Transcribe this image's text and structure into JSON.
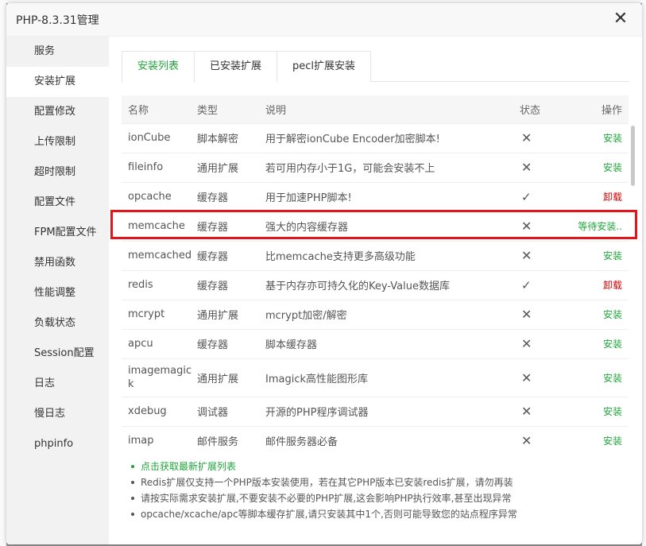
{
  "window": {
    "title": "PHP-8.3.31管理",
    "close_glyph": "✕"
  },
  "sidebar": {
    "items": [
      {
        "label": "服务"
      },
      {
        "label": "安装扩展",
        "active": true
      },
      {
        "label": "配置修改"
      },
      {
        "label": "上传限制"
      },
      {
        "label": "超时限制"
      },
      {
        "label": "配置文件"
      },
      {
        "label": "FPM配置文件"
      },
      {
        "label": "禁用函数"
      },
      {
        "label": "性能调整"
      },
      {
        "label": "负载状态"
      },
      {
        "label": "Session配置"
      },
      {
        "label": "日志"
      },
      {
        "label": "慢日志"
      },
      {
        "label": "phpinfo"
      }
    ]
  },
  "tabs": [
    {
      "label": "安装列表",
      "active": true
    },
    {
      "label": "已安装扩展"
    },
    {
      "label": "pecl扩展安装"
    }
  ],
  "table": {
    "headers": {
      "name": "名称",
      "type": "类型",
      "desc": "说明",
      "status": "状态",
      "op": "操作"
    },
    "rows": [
      {
        "name": "ionCube",
        "type": "脚本解密",
        "desc": "用于解密ionCube Encoder加密脚本!",
        "status": "✕",
        "op": "安装",
        "op_kind": "install"
      },
      {
        "name": "fileinfo",
        "type": "通用扩展",
        "desc": "若可用内存小于1G，可能会安装不上",
        "status": "✕",
        "op": "安装",
        "op_kind": "install"
      },
      {
        "name": "opcache",
        "type": "缓存器",
        "desc": "用于加速PHP脚本!",
        "status": "✓",
        "op": "卸载",
        "op_kind": "uninstall"
      },
      {
        "name": "memcache",
        "type": "缓存器",
        "desc": "强大的内容缓存器",
        "status": "✕",
        "op": "等待安装..",
        "op_kind": "pending"
      },
      {
        "name": "memcached",
        "type": "缓存器",
        "desc": "比memcache支持更多高级功能",
        "status": "✕",
        "op": "安装",
        "op_kind": "install"
      },
      {
        "name": "redis",
        "type": "缓存器",
        "desc": "基于内存亦可持久化的Key-Value数据库",
        "status": "✓",
        "op": "卸载",
        "op_kind": "uninstall"
      },
      {
        "name": "mcrypt",
        "type": "通用扩展",
        "desc": "mcrypt加密/解密",
        "status": "✕",
        "op": "安装",
        "op_kind": "install"
      },
      {
        "name": "apcu",
        "type": "缓存器",
        "desc": "脚本缓存器",
        "status": "✕",
        "op": "安装",
        "op_kind": "install"
      },
      {
        "name": "imagemagick",
        "name_line1": "imagemagic",
        "name_line2": "k",
        "type": "通用扩展",
        "desc": "Imagick高性能图形库",
        "status": "✕",
        "op": "安装",
        "op_kind": "install"
      },
      {
        "name": "xdebug",
        "type": "调试器",
        "desc": "开源的PHP程序调试器",
        "status": "✕",
        "op": "安装",
        "op_kind": "install"
      },
      {
        "name": "imap",
        "type": "邮件服务",
        "desc": "邮件服务器必备",
        "status": "✕",
        "op": "安装",
        "op_kind": "install"
      }
    ]
  },
  "notes": [
    "点击获取最新扩展列表",
    "Redis扩展仅支持一个PHP版本安装使用，若在其它PHP版本已安装redis扩展，请勿再装",
    "请按实际需求安装扩展,不要安装不必要的PHP扩展,这会影响PHP执行效率,甚至出现异常",
    "opcache/xcache/apc等脚本缓存扩展,请只安装其中1个,否则可能导致您的站点程序异常"
  ],
  "colors": {
    "accent_green": "#20a53a",
    "uninstall_red": "#cc0000",
    "highlight_red": "#e4151a"
  }
}
